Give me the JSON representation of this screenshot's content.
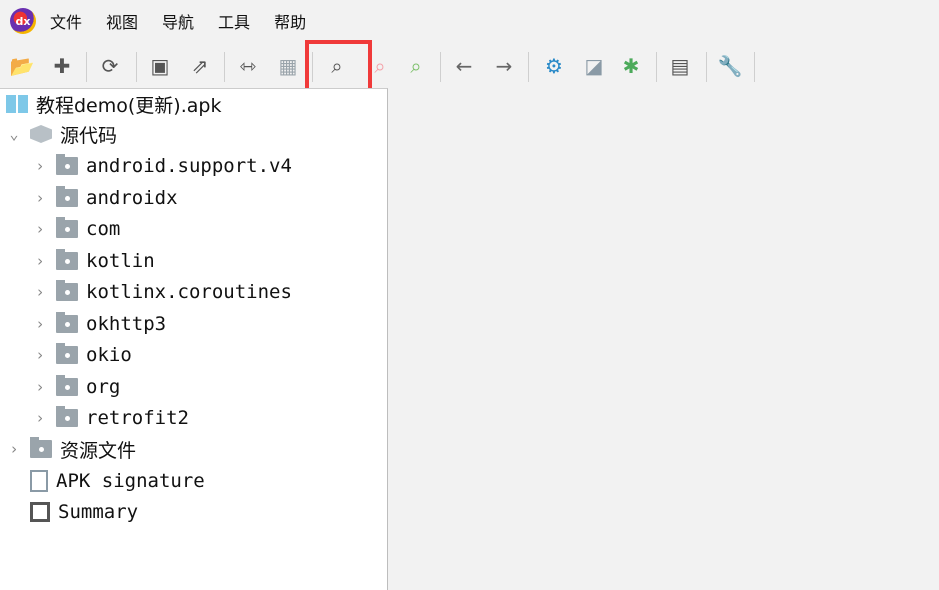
{
  "menu": [
    "文件",
    "视图",
    "导航",
    "工具",
    "帮助"
  ],
  "toolbar": [
    {
      "icon": "open-folder-icon",
      "glyph": "📂",
      "color": "#555"
    },
    {
      "icon": "add-file-icon",
      "glyph": "✚",
      "color": "#555"
    },
    {
      "icon": "reload-icon",
      "glyph": "⟳",
      "color": "#555"
    },
    {
      "icon": "save-icon",
      "glyph": "▣",
      "color": "#555"
    },
    {
      "icon": "export-icon",
      "glyph": "⇗",
      "color": "#555"
    },
    {
      "icon": "sync-editor-icon",
      "glyph": "⇿",
      "color": "#555"
    },
    {
      "icon": "flatten-packages-icon",
      "glyph": "▦",
      "color": "#9aa4ab"
    },
    {
      "icon": "search-icon",
      "glyph": "⌕",
      "color": "#555"
    },
    {
      "icon": "class-search-icon",
      "glyph": "⌕",
      "color": "#f4a0a8"
    },
    {
      "icon": "usage-search-icon",
      "glyph": "⌕",
      "color": "#7cc06a"
    },
    {
      "icon": "back-icon",
      "glyph": "←",
      "color": "#666"
    },
    {
      "icon": "forward-icon",
      "glyph": "→",
      "color": "#666"
    },
    {
      "icon": "deobfuscation-icon",
      "glyph": "⚙",
      "color": "#2a8ac8"
    },
    {
      "icon": "quark-icon",
      "glyph": "◪",
      "color": "#8a9aa6"
    },
    {
      "icon": "debug-icon",
      "glyph": "✱",
      "color": "#4caa5a"
    },
    {
      "icon": "log-icon",
      "glyph": "▤",
      "color": "#555"
    },
    {
      "icon": "preferences-icon",
      "glyph": "🔧",
      "color": "#555"
    }
  ],
  "tree": {
    "root": "教程demo(更新).apk",
    "source": "源代码",
    "packages": [
      "android.support.v4",
      "androidx",
      "com",
      "kotlin",
      "kotlinx.coroutines",
      "okhttp3",
      "okio",
      "org",
      "retrofit2"
    ],
    "resources": "资源文件",
    "signature": "APK signature",
    "summary": "Summary"
  }
}
